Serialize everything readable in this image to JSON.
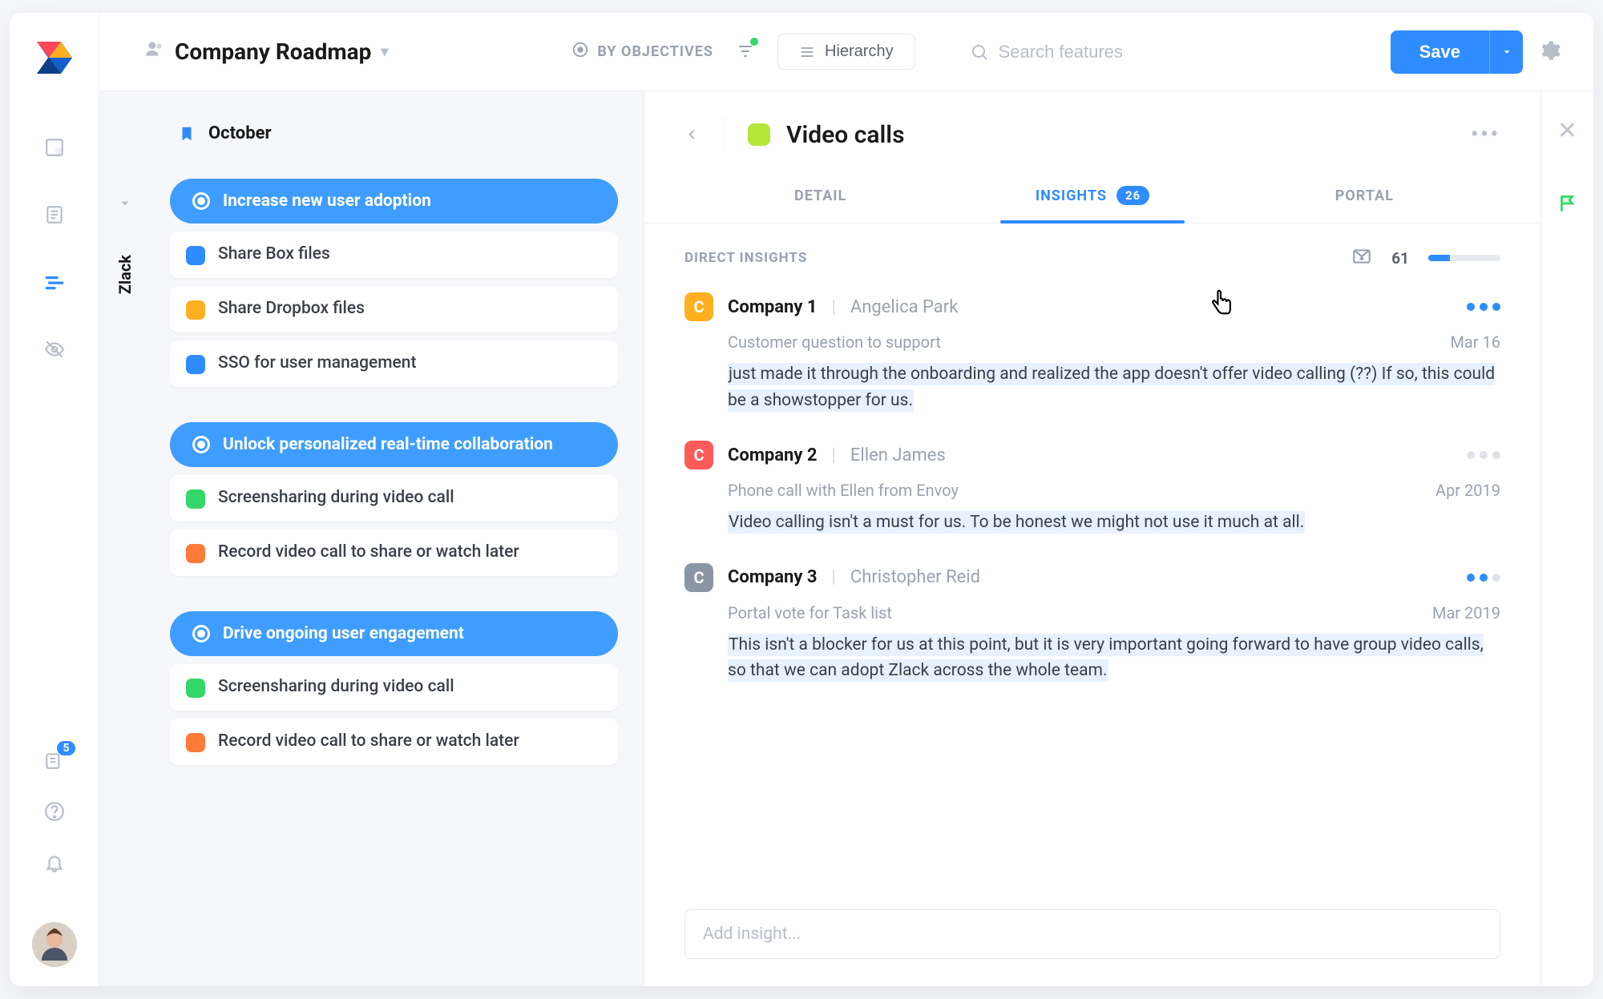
{
  "rail": {
    "badge": "5"
  },
  "topbar": {
    "roadmap_name": "Company Roadmap",
    "by_objectives": "BY OBJECTIVES",
    "hierarchy": "Hierarchy",
    "search_placeholder": "Search features",
    "save": "Save"
  },
  "roadmap": {
    "lane": "Zlack",
    "month": "October",
    "groups": [
      {
        "title": "Increase new user adoption",
        "features": [
          {
            "color": "blue",
            "label": "Share Box files"
          },
          {
            "color": "yellow",
            "label": "Share Dropbox files"
          },
          {
            "color": "blue",
            "label": "SSO for user management"
          }
        ]
      },
      {
        "title": "Unlock personalized real-time collaboration",
        "features": [
          {
            "color": "green",
            "label": "Screensharing during video call"
          },
          {
            "color": "orange",
            "label": "Record video call to share or watch later"
          }
        ]
      },
      {
        "title": "Drive ongoing user engagement",
        "features": [
          {
            "color": "green",
            "label": "Screensharing during video call"
          },
          {
            "color": "orange",
            "label": "Record video call to share or watch later"
          }
        ]
      }
    ]
  },
  "detail": {
    "title": "Video calls",
    "tabs": {
      "detail": "DETAIL",
      "insights": "INSIGHTS",
      "portal": "PORTAL",
      "insights_count": "26"
    },
    "direct_insights_label": "DIRECT INSIGHTS",
    "score": "61",
    "add_placeholder": "Add insight...",
    "insights": [
      {
        "chip": "C",
        "chipClass": "chip-c1",
        "company": "Company 1",
        "author": "Angelica Park",
        "meta": "Customer question to support",
        "date": "Mar 16",
        "body": "just made it through the onboarding and realized the app doesn't offer video calling (??) If so, this could be a showstopper for us.",
        "dots": [
          "on",
          "on",
          "on"
        ]
      },
      {
        "chip": "C",
        "chipClass": "chip-c2",
        "company": "Company 2",
        "author": "Ellen James",
        "meta": "Phone call with Ellen from Envoy",
        "date": "Apr 2019",
        "body": "Video calling isn't a must for us. To be honest we might not use it much at all.",
        "dots": [
          "off",
          "off",
          "off"
        ]
      },
      {
        "chip": "C",
        "chipClass": "chip-c3",
        "company": "Company 3",
        "author": "Christopher Reid",
        "meta": "Portal vote for Task list",
        "date": "Mar 2019",
        "body": "This isn't a blocker for us at this point, but it is very important going forward to have group video calls, so that we can adopt Zlack across the whole team.",
        "dots": [
          "on",
          "on",
          "off"
        ]
      }
    ]
  }
}
